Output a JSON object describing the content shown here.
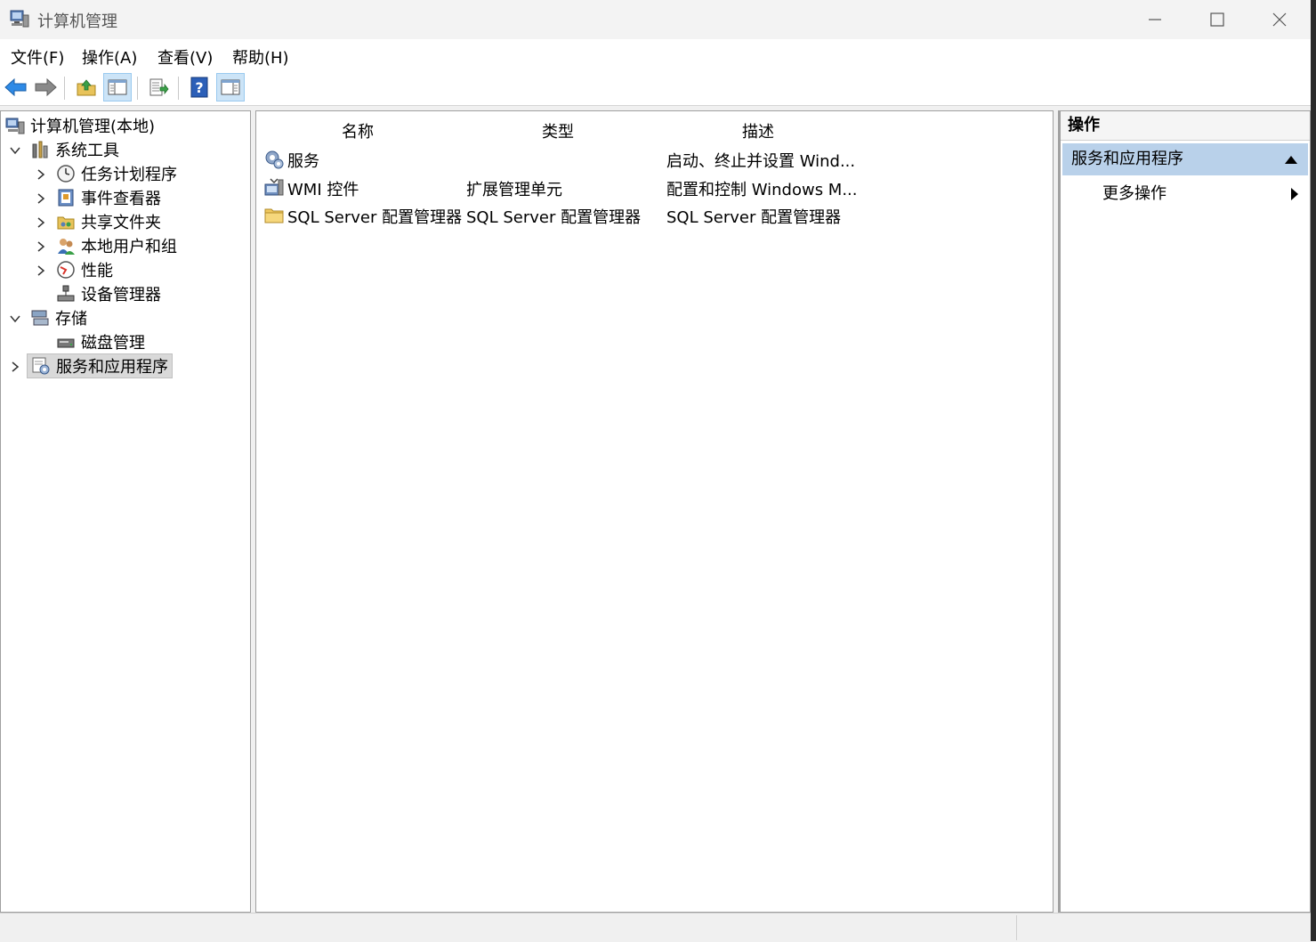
{
  "window": {
    "title": "计算机管理"
  },
  "menu": [
    "文件(F)",
    "操作(A)",
    "查看(V)",
    "帮助(H)"
  ],
  "toolbar": {
    "buttons": [
      "back-arrow-icon",
      "forward-arrow-icon",
      "up-folder-icon",
      "show-hide-tree-icon",
      "export-list-icon",
      "help-icon",
      "show-hide-action-pane-icon"
    ]
  },
  "tree": {
    "root": "计算机管理(本地)",
    "system_tools": "系统工具",
    "task_scheduler": "任务计划程序",
    "event_viewer": "事件查看器",
    "shared_folders": "共享文件夹",
    "local_users": "本地用户和组",
    "performance": "性能",
    "device_manager": "设备管理器",
    "storage": "存储",
    "disk_management": "磁盘管理",
    "services_apps": "服务和应用程序"
  },
  "list": {
    "columns": [
      "名称",
      "类型",
      "描述"
    ],
    "rows": [
      {
        "name": "服务",
        "type": "",
        "desc": "启动、终止并设置 Wind..."
      },
      {
        "name": "WMI 控件",
        "type": "扩展管理单元",
        "desc": "配置和控制 Windows M..."
      },
      {
        "name": "SQL Server 配置管理器",
        "type": "SQL Server 配置管理器",
        "desc": "SQL Server 配置管理器"
      }
    ]
  },
  "actions": {
    "header": "操作",
    "group": "服务和应用程序",
    "more": "更多操作"
  },
  "colors": {
    "selection": "#b9d1ea",
    "accent_blue": "#1e73d8"
  }
}
